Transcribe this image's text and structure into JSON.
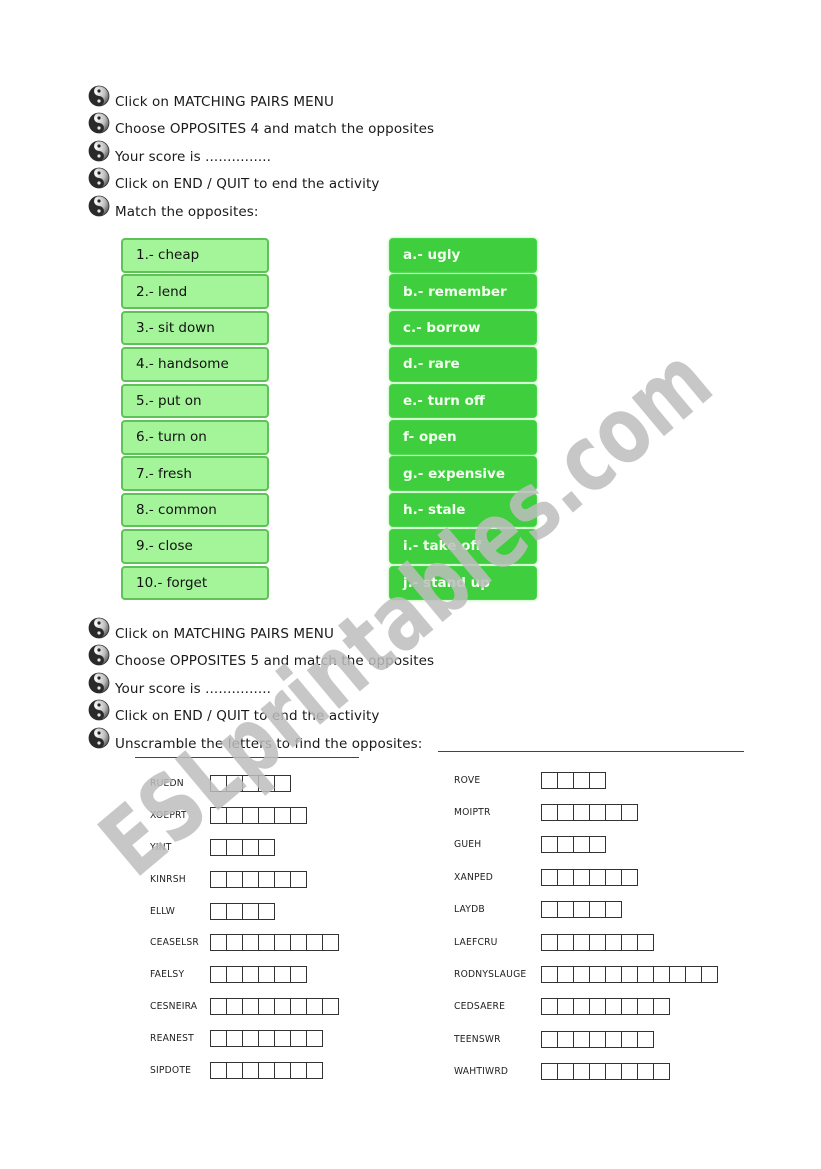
{
  "section1": {
    "instructions": [
      "Click on MATCHING PAIRS MENU",
      "Choose OPPOSITES 4 and match the opposites",
      "Your score is ...............",
      "Click on END / QUIT to end the activity",
      "Match the opposites:"
    ],
    "left_items": [
      "1.- cheap",
      "2.- lend",
      "3.- sit down",
      "4.- handsome",
      "5.- put on",
      "6.- turn on",
      "7.- fresh",
      "8.- common",
      "9.- close",
      "10.- forget"
    ],
    "right_items": [
      "a.- ugly",
      "b.- remember",
      "c.- borrow",
      "d.- rare",
      "e.- turn off",
      "f- open",
      "g.- expensive",
      "h.- stale",
      "i.- take off",
      "j.- stand up"
    ]
  },
  "section2": {
    "instructions": [
      "Click on MATCHING PAIRS MENU",
      "Choose OPPOSITES 5 and match the opposites",
      "Your score is ...............",
      "Click on END / QUIT to end the activity",
      "Unscramble the letters to find the opposites:"
    ],
    "scramble_left": [
      {
        "word": "RUEDN",
        "boxes": 5
      },
      {
        "word": "XOEPRT",
        "boxes": 6
      },
      {
        "word": "YINT",
        "boxes": 4
      },
      {
        "word": "KINRSH",
        "boxes": 6
      },
      {
        "word": "ELLW",
        "boxes": 4
      },
      {
        "word": "CEASELSR",
        "boxes": 8
      },
      {
        "word": "FAELSY",
        "boxes": 6
      },
      {
        "word": "CESNEIRA",
        "boxes": 8
      },
      {
        "word": "REANEST",
        "boxes": 7
      },
      {
        "word": "SIPDOTE",
        "boxes": 7
      }
    ],
    "scramble_right": [
      {
        "word": "ROVE",
        "boxes": 4
      },
      {
        "word": "MOIPTR",
        "boxes": 6
      },
      {
        "word": "GUEH",
        "boxes": 4
      },
      {
        "word": "XANPED",
        "boxes": 6
      },
      {
        "word": "LAYDB",
        "boxes": 5
      },
      {
        "word": "LAEFCRU",
        "boxes": 7
      },
      {
        "word": "RODNYSLAUGE",
        "boxes": 11
      },
      {
        "word": "CEDSAERE",
        "boxes": 8
      },
      {
        "word": "TEENSWR",
        "boxes": 7
      },
      {
        "word": "WAHTIWRD",
        "boxes": 8
      }
    ]
  },
  "bullet_icon": "yin-yang-icon",
  "watermark": "ESLprintables.com",
  "colors": {
    "tile_light": "#a4f49a",
    "tile_light_border": "#5fc259",
    "tile_dark": "#3fce3d",
    "watermark": "#c8c8c8"
  }
}
